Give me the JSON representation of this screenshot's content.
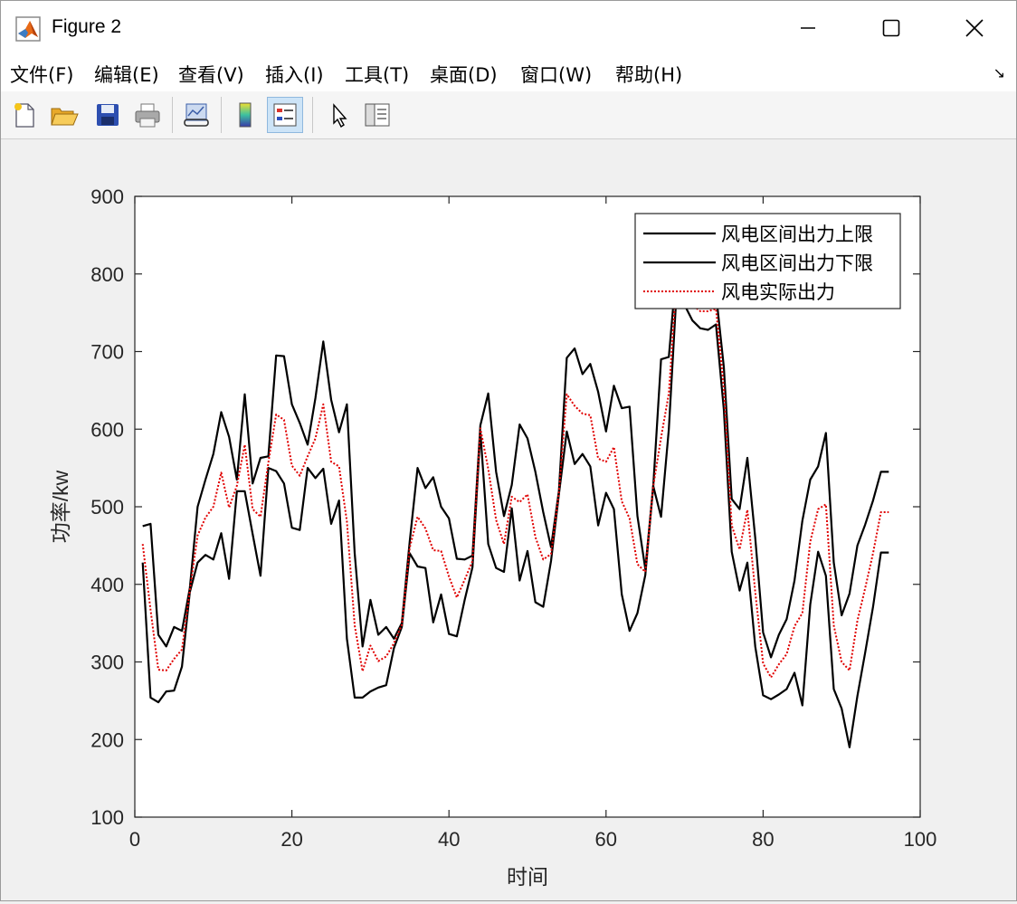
{
  "window": {
    "title": "Figure 2"
  },
  "menu": [
    "文件(F)",
    "编辑(E)",
    "查看(V)",
    "插入(I)",
    "工具(T)",
    "桌面(D)",
    "窗口(W)",
    "帮助(H)"
  ],
  "toolbar": {
    "icons": [
      "new-figure-icon",
      "open-file-icon",
      "save-icon",
      "print-icon",
      "link-plot-icon",
      "insert-colorbar-icon",
      "insert-legend-icon",
      "edit-plot-icon",
      "property-inspector-icon"
    ],
    "active": "insert-legend-icon"
  },
  "colors": {
    "bounds": "#000000",
    "actual": "#e00000"
  },
  "chart_data": {
    "type": "line",
    "xlabel": "时间",
    "ylabel": "功率/kw",
    "xlim": [
      0,
      100
    ],
    "ylim": [
      100,
      900
    ],
    "xticks": [
      0,
      20,
      40,
      60,
      80,
      100
    ],
    "yticks": [
      100,
      200,
      300,
      400,
      500,
      600,
      700,
      800,
      900
    ],
    "grid": false,
    "legend_position": "top-right",
    "x": [
      1,
      2,
      3,
      4,
      5,
      6,
      7,
      8,
      9,
      10,
      11,
      12,
      13,
      14,
      15,
      16,
      17,
      18,
      19,
      20,
      21,
      22,
      23,
      24,
      25,
      26,
      27,
      28,
      29,
      30,
      31,
      32,
      33,
      34,
      35,
      36,
      37,
      38,
      39,
      40,
      41,
      42,
      43,
      44,
      45,
      46,
      47,
      48,
      49,
      50,
      51,
      52,
      53,
      54,
      55,
      56,
      57,
      58,
      59,
      60,
      61,
      62,
      63,
      64,
      65,
      66,
      67,
      68,
      69,
      70,
      71,
      72,
      73,
      74,
      75,
      76,
      77,
      78,
      79,
      80,
      81,
      82,
      83,
      84,
      85,
      86,
      87,
      88,
      89,
      90,
      91,
      92,
      93,
      94,
      95,
      96
    ],
    "series": [
      {
        "name": "风电区间出力上限",
        "style": "solid",
        "values": [
          475,
          478,
          335,
          320,
          345,
          340,
          395,
          500,
          535,
          568,
          622,
          590,
          535,
          645,
          530,
          563,
          565,
          695,
          694,
          632,
          608,
          580,
          640,
          713,
          638,
          596,
          632,
          440,
          320,
          380,
          335,
          345,
          330,
          350,
          455,
          550,
          524,
          538,
          500,
          485,
          433,
          432,
          437,
          605,
          646,
          545,
          488,
          528,
          606,
          588,
          545,
          493,
          448,
          520,
          692,
          704,
          671,
          684,
          648,
          597,
          656,
          627,
          629,
          488,
          420,
          525,
          690,
          693,
          810,
          808,
          780,
          775,
          775,
          775,
          680,
          510,
          497,
          563,
          460,
          338,
          306,
          335,
          355,
          405,
          482,
          535,
          552,
          595,
          428,
          360,
          388,
          450,
          477,
          508,
          545,
          545
        ]
      },
      {
        "name": "风电区间出力下限",
        "style": "solid",
        "values": [
          428,
          254,
          248,
          262,
          263,
          294,
          390,
          428,
          438,
          432,
          466,
          407,
          520,
          520,
          465,
          411,
          550,
          546,
          530,
          473,
          470,
          550,
          537,
          549,
          478,
          508,
          330,
          254,
          254,
          262,
          267,
          270,
          318,
          345,
          440,
          423,
          421,
          351,
          387,
          336,
          333,
          380,
          422,
          597,
          452,
          421,
          416,
          498,
          405,
          443,
          377,
          371,
          430,
          516,
          597,
          555,
          568,
          552,
          476,
          518,
          497,
          387,
          340,
          363,
          412,
          527,
          487,
          600,
          780,
          760,
          740,
          730,
          728,
          735,
          625,
          442,
          392,
          428,
          320,
          257,
          252,
          258,
          265,
          286,
          244,
          374,
          442,
          411,
          265,
          240,
          190,
          256,
          312,
          371,
          441,
          441
        ]
      },
      {
        "name": "风电实际出力",
        "style": "dotted",
        "values": [
          452,
          367,
          290,
          289,
          304,
          316,
          392,
          463,
          486,
          500,
          544,
          499,
          527,
          580,
          497,
          487,
          557,
          619,
          612,
          553,
          540,
          565,
          588,
          632,
          558,
          552,
          481,
          347,
          288,
          321,
          301,
          307,
          324,
          348,
          447,
          487,
          472,
          444,
          443,
          410,
          383,
          406,
          430,
          601,
          549,
          483,
          452,
          513,
          506,
          516,
          461,
          432,
          439,
          518,
          645,
          630,
          620,
          618,
          562,
          558,
          577,
          507,
          485,
          426,
          416,
          526,
          589,
          646,
          795,
          784,
          760,
          752,
          752,
          755,
          653,
          476,
          445,
          496,
          390,
          298,
          280,
          297,
          310,
          346,
          363,
          455,
          497,
          503,
          347,
          300,
          289,
          353,
          395,
          440,
          493,
          493
        ]
      }
    ]
  }
}
